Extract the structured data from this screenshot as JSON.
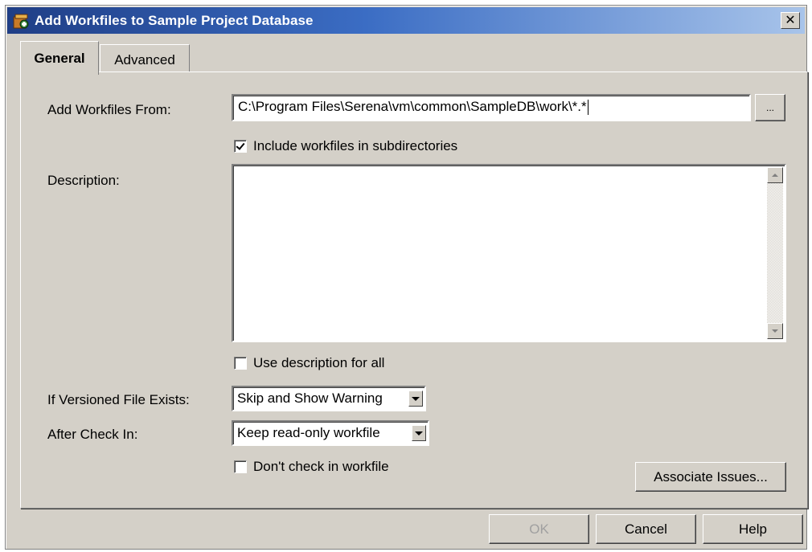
{
  "window": {
    "title": "Add Workfiles to Sample Project Database",
    "close_label": "✕"
  },
  "tabs": [
    {
      "label": "General",
      "active": true
    },
    {
      "label": "Advanced",
      "active": false
    }
  ],
  "general": {
    "add_from_label": "Add Workfiles From:",
    "add_from_value": "C:\\Program Files\\Serena\\vm\\common\\SampleDB\\work\\*.*",
    "browse_label": "...",
    "include_subdirs_label": "Include workfiles in subdirectories",
    "include_subdirs_checked": true,
    "description_label": "Description:",
    "description_value": "",
    "use_desc_all_label": "Use description for all",
    "use_desc_all_checked": false,
    "versioned_exists_label": "If Versioned File Exists:",
    "versioned_exists_value": "Skip and Show Warning",
    "after_checkin_label": "After Check In:",
    "after_checkin_value": "Keep read-only workfile",
    "dont_checkin_label": "Don't check in workfile",
    "dont_checkin_checked": false,
    "associate_issues_label": "Associate Issues..."
  },
  "footer": {
    "ok_label": "OK",
    "cancel_label": "Cancel",
    "help_label": "Help"
  }
}
